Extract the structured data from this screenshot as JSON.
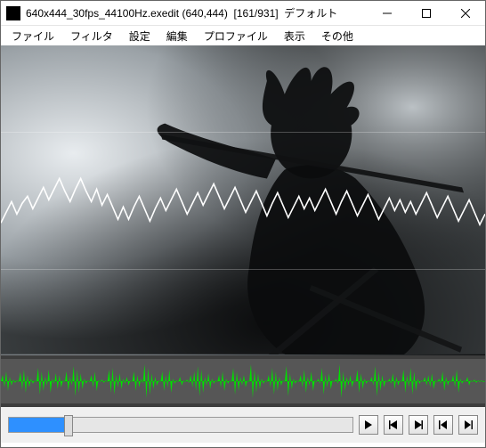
{
  "titlebar": {
    "filename": "640x444_30fps_44100Hz.exedit",
    "resolution": "(640,444)",
    "frame_position": "[161/931]",
    "profile_name": "デフォルト"
  },
  "menu": {
    "items": [
      "ファイル",
      "フィルタ",
      "設定",
      "編集",
      "プロファイル",
      "表示",
      "その他"
    ]
  },
  "playback": {
    "current_frame": 161,
    "total_frames": 931,
    "progress_percent": 17.3
  },
  "icons": {
    "minimize": "minimize-icon",
    "maximize": "maximize-icon",
    "close": "close-icon",
    "play": "play-icon",
    "step_back": "step-back-icon",
    "step_fwd": "step-forward-icon",
    "to_start": "to-start-icon",
    "to_end": "to-end-icon"
  },
  "colors": {
    "waveform": "#00e000",
    "seek_fill": "#2e90ff"
  }
}
